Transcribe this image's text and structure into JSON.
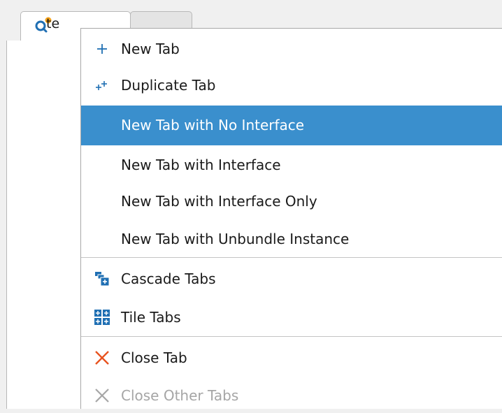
{
  "tab": {
    "active_label": "te",
    "search_icon": "search-icon-with-orange-dot"
  },
  "menu": {
    "items": [
      {
        "label": "New Tab",
        "icon": "plus-icon"
      },
      {
        "label": "Duplicate Tab",
        "icon": "duplicate-plus-icon"
      },
      {
        "label": "New Tab with No Interface",
        "selected": true
      },
      {
        "label": "New Tab with Interface"
      },
      {
        "label": "New Tab with Interface Only"
      },
      {
        "label": "New Tab with Unbundle Instance"
      },
      {
        "label": "Cascade Tabs",
        "icon": "cascade-icon"
      },
      {
        "label": "Tile Tabs",
        "icon": "tile-icon"
      },
      {
        "label": "Close Tab",
        "icon": "close-x-icon"
      },
      {
        "label": "Close Other Tabs",
        "icon": "close-x-icon",
        "disabled": true
      }
    ]
  },
  "colors": {
    "selection": "#3a8fcd",
    "plus": "#1f6fb3",
    "close": "#e8531f",
    "disabled": "#a6a6a6",
    "search_dot": "#f5a21a"
  }
}
